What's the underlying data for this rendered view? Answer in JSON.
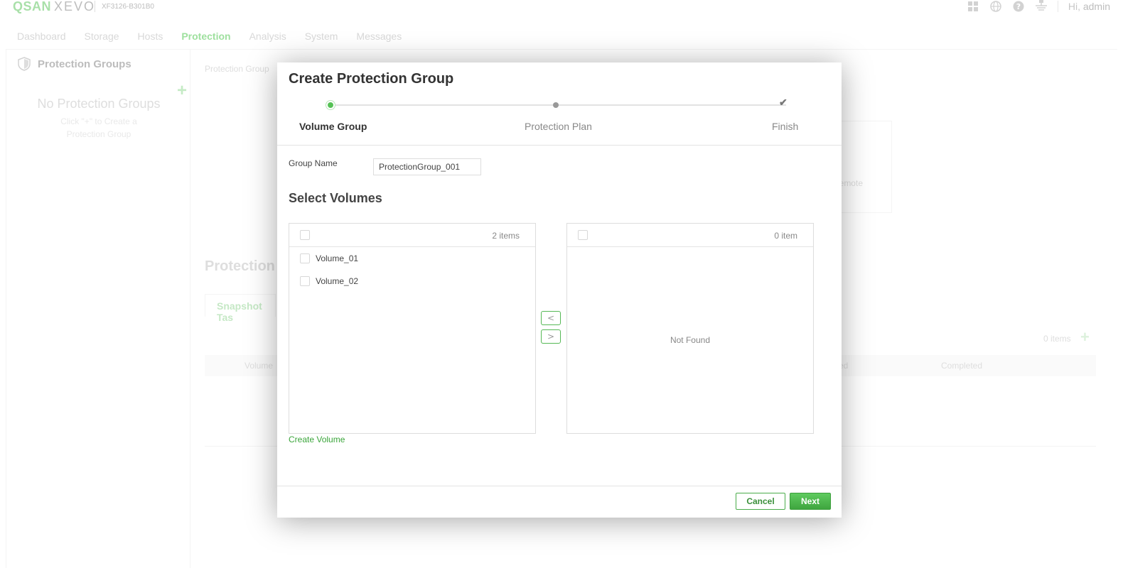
{
  "app": {
    "logo_brand": "QSAN",
    "logo_product": "XEVO",
    "model": "XF3126-B301B0",
    "greeting_prefix": "Hi,",
    "greeting_user": "admin",
    "icons": [
      "apps-grid-icon",
      "globe-icon",
      "help-icon",
      "network-icon"
    ]
  },
  "nav": {
    "items": [
      "Dashboard",
      "Storage",
      "Hosts",
      "Protection",
      "Analysis",
      "System",
      "Messages"
    ],
    "active": "Protection"
  },
  "sidebar": {
    "title": "Protection Groups",
    "empty_title": "No Protection Groups",
    "empty_hint": "Click \"+\" to Create a Protection Group"
  },
  "background": {
    "breadcrumb": "Protection Group",
    "remote_fragment": "emote",
    "section_fragment": "Protection V",
    "tab_fragment": "Snapshot Tas",
    "items_count": "0 items",
    "col_volume": "Volume",
    "col_fragment": "ed",
    "col_completed": "Completed"
  },
  "modal": {
    "title": "Create Protection Group",
    "steps": [
      "Volume Group",
      "Protection Plan",
      "Finish"
    ],
    "current_step": 1,
    "group_name_label": "Group Name",
    "group_name_value": "ProtectionGroup_001",
    "select_title": "Select Volumes",
    "left_count": "2 items",
    "right_count": "0 item",
    "volumes": [
      "Volume_01",
      "Volume_02"
    ],
    "not_found": "Not Found",
    "move_left": "<",
    "move_right": ">",
    "create_volume": "Create Volume",
    "cancel": "Cancel",
    "next": "Next"
  },
  "colors": {
    "accent": "#55c155",
    "accent_dark": "#3a8f3a"
  }
}
